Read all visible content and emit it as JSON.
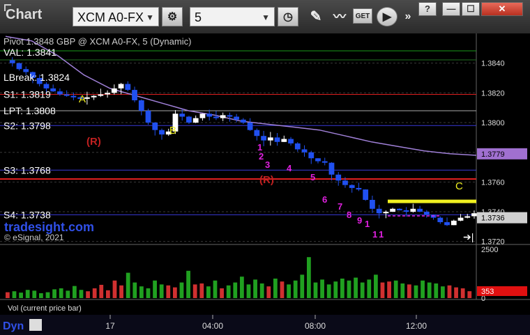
{
  "toolbar": {
    "title": "Chart",
    "symbol": "XCM A0-FX",
    "interval": "5",
    "get_label": "GET",
    "window_buttons": [
      "?",
      "—",
      "☐",
      "✕"
    ]
  },
  "header_text": {
    "overlap_text": "Pivot 1.3848 GBP @ XCM A0-FX, 5 (Dynamic)",
    "val": "VAL: 1.3841",
    "lbreak": "LBreak: 1.3824"
  },
  "levels": [
    {
      "label": "S1: 1.3819",
      "value": 1.3819,
      "color": "#e02020"
    },
    {
      "label": "LPT: 1.3808",
      "value": 1.3808,
      "color": "#aaaaaa"
    },
    {
      "label": "S2: 1.3798",
      "value": 1.3798,
      "color": "#3a3ad8"
    },
    {
      "label": "S3: 1.3768",
      "value": 1.3768,
      "color": "#3a3ad8"
    },
    {
      "label": "S4: 1.3738",
      "value": 1.3738,
      "color": "#3a3ad8"
    }
  ],
  "watermark": "tradesight.com",
  "copyright": "© eSignal, 2021",
  "annotations": {
    "wave": [
      "A",
      "B",
      "C"
    ],
    "r_markers": [
      "(R)",
      "(R)"
    ],
    "countdown": [
      "1",
      "2",
      "3",
      "4",
      "5",
      "6",
      "7",
      "8",
      "9",
      "1",
      "1",
      "1"
    ]
  },
  "chart_data": {
    "type": "candlestick",
    "y_axis": {
      "min": 1.3718,
      "max": 1.386,
      "ticks": [
        "1.3840",
        "1.3820",
        "1.3800",
        "1.3780",
        "1.3760",
        "1.3740",
        "1.3720"
      ],
      "tick_values": [
        1.384,
        1.382,
        1.38,
        1.378,
        1.376,
        1.374,
        1.372
      ]
    },
    "x_axis": {
      "ticks": [
        "17",
        "04:00",
        "08:00",
        "12:00"
      ]
    },
    "price_tags": [
      {
        "label": "1.3779",
        "value": 1.3779,
        "color": "#a070d0"
      },
      {
        "label": "1.3736",
        "value": 1.3736,
        "color": "#d0d0d0"
      }
    ],
    "price_path": [
      1.3842,
      1.384,
      1.3836,
      1.3834,
      1.383,
      1.3826,
      1.3823,
      1.3821,
      1.3819,
      1.3818,
      1.3817,
      1.3816,
      1.3817,
      1.3818,
      1.3819,
      1.382,
      1.3823,
      1.3826,
      1.3822,
      1.3815,
      1.3808,
      1.38,
      1.3795,
      1.3792,
      1.3794,
      1.3806,
      1.3804,
      1.38,
      1.3803,
      1.3806,
      1.3804,
      1.3803,
      1.3805,
      1.3804,
      1.3802,
      1.38,
      1.3795,
      1.3791,
      1.3788,
      1.379,
      1.3787,
      1.3789,
      1.3786,
      1.3782,
      1.378,
      1.3776,
      1.3774,
      1.3773,
      1.3765,
      1.3761,
      1.3758,
      1.3756,
      1.3755,
      1.3748,
      1.3742,
      1.3739,
      1.374,
      1.3742,
      1.3741,
      1.374,
      1.3742,
      1.374,
      1.3738,
      1.3736,
      1.3733,
      1.3731,
      1.3734,
      1.3736,
      1.3737,
      1.3739
    ],
    "moving_average": [
      1.3858,
      1.3855,
      1.3845,
      1.3832,
      1.3823,
      1.3818,
      1.3813,
      1.3808,
      1.3805,
      1.3801,
      1.3799,
      1.3797,
      1.3795,
      1.3791,
      1.3787,
      1.3784,
      1.3781,
      1.3779,
      1.3778
    ],
    "c_target": 1.3747,
    "volume": {
      "ticks": [
        "2500",
        "0"
      ],
      "max": 2500,
      "last": "353",
      "label": "Vol (current price bar)",
      "values": [
        300,
        350,
        280,
        420,
        380,
        250,
        300,
        450,
        500,
        380,
        620,
        420,
        350,
        500,
        680,
        400,
        900,
        650,
        1300,
        800,
        600,
        500,
        900,
        700,
        650,
        550,
        800,
        1400,
        700,
        750,
        600,
        900,
        500,
        650,
        800,
        1100,
        700,
        950,
        750,
        600,
        1000,
        850,
        700,
        900,
        1200,
        2100,
        800,
        950,
        700,
        850,
        1000,
        900,
        1050,
        800,
        950,
        1200,
        800,
        850,
        900,
        750,
        700,
        650,
        900,
        800,
        750,
        600,
        650,
        550,
        500,
        353
      ]
    }
  }
}
